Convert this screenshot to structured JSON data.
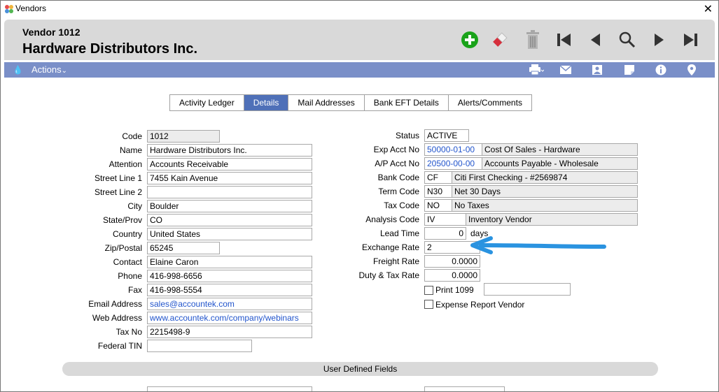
{
  "window": {
    "title": "Vendors",
    "close_glyph": "✕"
  },
  "header": {
    "vendor_number": "Vendor 1012",
    "vendor_name": "Hardware Distributors Inc."
  },
  "toolbar": {
    "icons": [
      "add-icon",
      "erase-icon",
      "trash-icon",
      "first-record-icon",
      "previous-record-icon",
      "search-icon",
      "next-record-icon",
      "last-record-icon"
    ],
    "add_color": "#1aa31a"
  },
  "actionbar": {
    "actions_label": "Actions",
    "chevron": "⌄",
    "icons": [
      "print-icon",
      "mail-icon",
      "contact-card-icon",
      "note-icon",
      "info-icon",
      "location-pin-icon"
    ],
    "bar_color": "#7a8fc8"
  },
  "tabs": [
    {
      "label": "Activity Ledger",
      "active": false
    },
    {
      "label": "Details",
      "active": true
    },
    {
      "label": "Mail Addresses",
      "active": false
    },
    {
      "label": "Bank EFT Details",
      "active": false
    },
    {
      "label": "Alerts/Comments",
      "active": false
    }
  ],
  "left": {
    "code": {
      "label": "Code",
      "value": "1012"
    },
    "name": {
      "label": "Name",
      "value": "Hardware Distributors Inc."
    },
    "attention": {
      "label": "Attention",
      "value": "Accounts Receivable"
    },
    "street1": {
      "label": "Street Line 1",
      "value": "7455 Kain Avenue"
    },
    "street2": {
      "label": "Street Line 2",
      "value": ""
    },
    "city": {
      "label": "City",
      "value": "Boulder"
    },
    "state": {
      "label": "State/Prov",
      "value": "CO"
    },
    "country": {
      "label": "Country",
      "value": "United States"
    },
    "zip": {
      "label": "Zip/Postal",
      "value": "65245"
    },
    "contact": {
      "label": "Contact",
      "value": "Elaine Caron"
    },
    "phone": {
      "label": "Phone",
      "value": "416-998-6656"
    },
    "fax": {
      "label": "Fax",
      "value": "416-998-5554"
    },
    "email": {
      "label": "Email Address",
      "value": "sales@accountek.com"
    },
    "web": {
      "label": "Web Address",
      "value": "www.accountek.com/company/webinars"
    },
    "taxno": {
      "label": "Tax No",
      "value": "2215498-9"
    },
    "federal_tin": {
      "label": "Federal TIN",
      "value": ""
    }
  },
  "right": {
    "status": {
      "label": "Status",
      "value": "ACTIVE"
    },
    "exp_acct": {
      "label": "Exp Acct No",
      "value": "50000-01-00",
      "desc": "Cost Of Sales - Hardware"
    },
    "ap_acct": {
      "label": "A/P Acct No",
      "value": "20500-00-00",
      "desc": "Accounts Payable - Wholesale"
    },
    "bank_code": {
      "label": "Bank Code",
      "value": "CF",
      "desc": "Citi First Checking - #2569874"
    },
    "term_code": {
      "label": "Term Code",
      "value": "N30",
      "desc": "Net 30 Days"
    },
    "tax_code": {
      "label": "Tax Code",
      "value": "NO",
      "desc": "No Taxes"
    },
    "analysis_code": {
      "label": "Analysis Code",
      "value": "IV",
      "desc": "Inventory Vendor"
    },
    "lead_time": {
      "label": "Lead Time",
      "value": "0",
      "unit": "days"
    },
    "exchange_rate": {
      "label": "Exchange Rate",
      "value": "2"
    },
    "freight_rate": {
      "label": "Freight Rate",
      "value": "0.0000"
    },
    "duty_tax_rate": {
      "label": "Duty & Tax Rate",
      "value": "0.0000"
    },
    "print1099": {
      "label": "Print 1099",
      "checked": false,
      "value": ""
    },
    "expense_vendor": {
      "label": "Expense Report Vendor",
      "checked": false
    }
  },
  "udf": {
    "label": "User Defined Fields"
  },
  "annotation": {
    "arrow_color": "#2a93e0"
  }
}
